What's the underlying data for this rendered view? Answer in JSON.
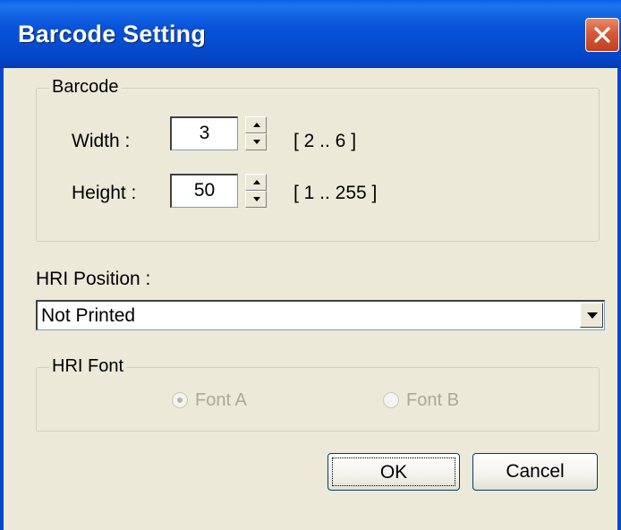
{
  "window": {
    "title": "Barcode Setting"
  },
  "barcode_group": {
    "label": "Barcode",
    "width": {
      "label": "Width :",
      "value": "3",
      "range": "[ 2 .. 6 ]"
    },
    "height": {
      "label": "Height :",
      "value": "50",
      "range": "[ 1 .. 255 ]"
    }
  },
  "hri_position": {
    "label": "HRI Position :",
    "selected": "Not Printed"
  },
  "hri_font_group": {
    "label": "HRI Font",
    "font_a": {
      "label": "Font A",
      "checked": true,
      "enabled": false
    },
    "font_b": {
      "label": "Font B",
      "checked": false,
      "enabled": false
    }
  },
  "buttons": {
    "ok": "OK",
    "cancel": "Cancel"
  },
  "icons": {
    "close": "close-icon",
    "spin_up": "arrow-up-icon",
    "spin_down": "arrow-down-icon",
    "dropdown": "chevron-down-icon"
  },
  "colors": {
    "titlebar": "#0553d8",
    "close_button": "#d04c2c",
    "dialog_bg": "#ece9d8",
    "disabled_text": "#aca899"
  }
}
